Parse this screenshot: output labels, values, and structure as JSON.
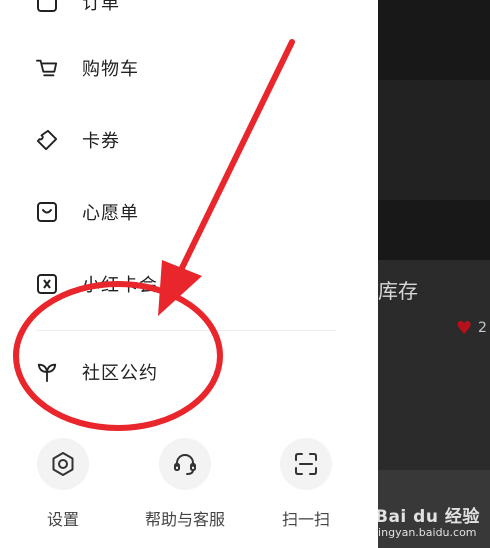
{
  "menu": {
    "items": [
      {
        "label": "订单",
        "icon": "order-icon"
      },
      {
        "label": "购物车",
        "icon": "cart-icon"
      },
      {
        "label": "卡券",
        "icon": "coupon-icon"
      },
      {
        "label": "心愿单",
        "icon": "wishlist-icon"
      },
      {
        "label": "小红卡会员",
        "icon": "member-card-icon"
      },
      {
        "label": "社区公约",
        "icon": "sprout-icon"
      }
    ]
  },
  "bottom": {
    "settings": "设置",
    "help": "帮助与客服",
    "scan": "扫一扫"
  },
  "background_feed": {
    "title_fragment": "库存",
    "like_count": "2"
  },
  "watermark": {
    "logo": "Bai du 经验",
    "url": "jingyan.baidu.com"
  },
  "colors": {
    "annotation_red": "#e8262b",
    "backdrop": "#2b2b2b"
  }
}
